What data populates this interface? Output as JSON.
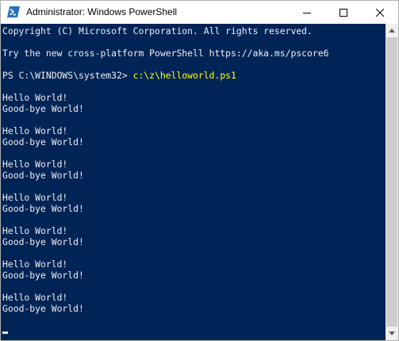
{
  "window": {
    "title": "Administrator: Windows PowerShell",
    "icon": "powershell-icon",
    "controls": [
      "minimize-icon",
      "maximize-icon",
      "close-icon"
    ]
  },
  "console": {
    "lines": [
      "Copyright (C) Microsoft Corporation. All rights reserved.",
      "",
      "Try the new cross-platform PowerShell https://aka.ms/pscore6",
      "",
      "PS C:\\WINDOWS\\system32> ",
      "",
      "Hello World!",
      "Good-bye World!",
      "",
      "Hello World!",
      "Good-bye World!",
      "",
      "Hello World!",
      "Good-bye World!",
      "",
      "Hello World!",
      "Good-bye World!",
      "",
      "Hello World!",
      "Good-bye World!",
      "",
      "Hello World!",
      "Good-bye World!",
      "",
      "Hello World!",
      "Good-bye World!"
    ],
    "command": "c:\\z\\helloworld.ps1"
  },
  "colors": {
    "background": "#012456",
    "text": "#eeedf0",
    "command": "#ffff00"
  }
}
